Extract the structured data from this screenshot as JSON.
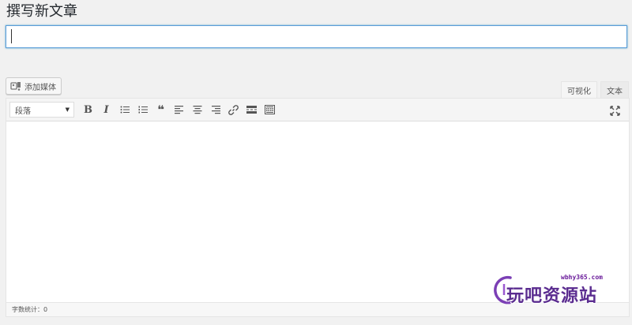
{
  "page": {
    "title": "撰写新文章"
  },
  "title_input": {
    "value": "",
    "placeholder": ""
  },
  "media": {
    "button_label": "添加媒体",
    "icon": "media-add-icon"
  },
  "tabs": [
    {
      "label": "可视化",
      "active": true
    },
    {
      "label": "文本",
      "active": false
    }
  ],
  "toolbar": {
    "format_select": "段落",
    "buttons": [
      {
        "name": "bold",
        "icon": "bold-icon"
      },
      {
        "name": "italic",
        "icon": "italic-icon"
      },
      {
        "name": "bulleted-list",
        "icon": "bullet-list-icon"
      },
      {
        "name": "numbered-list",
        "icon": "numbered-list-icon"
      },
      {
        "name": "blockquote",
        "icon": "quote-icon"
      },
      {
        "name": "align-left",
        "icon": "align-left-icon"
      },
      {
        "name": "align-center",
        "icon": "align-center-icon"
      },
      {
        "name": "align-right",
        "icon": "align-right-icon"
      },
      {
        "name": "insert-link",
        "icon": "link-icon"
      },
      {
        "name": "read-more",
        "icon": "more-tag-icon"
      },
      {
        "name": "toolbar-toggle",
        "icon": "kitchen-sink-icon"
      }
    ],
    "fullscreen_icon": "fullscreen-icon"
  },
  "status": {
    "word_count": "字数统计：0"
  },
  "watermark": {
    "url": "wbhy365.com",
    "text": "玩吧资源站"
  },
  "colors": {
    "accent": "#5b9dd9",
    "background": "#f1f1f1",
    "watermark": "#5b2d90"
  }
}
